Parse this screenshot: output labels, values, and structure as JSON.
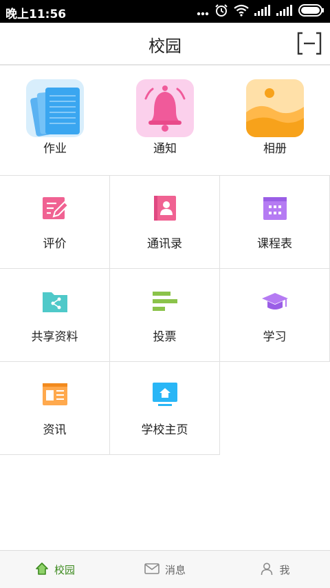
{
  "status_bar": {
    "time": "晚上11:56",
    "icons": [
      "dots-icon",
      "alarm-icon",
      "wifi-icon",
      "signal-icon",
      "signal-icon",
      "battery-icon"
    ]
  },
  "header": {
    "title": "校园",
    "scan_icon": "scan-icon"
  },
  "top_items": [
    {
      "label": "作业",
      "icon": "homework-notebook-icon"
    },
    {
      "label": "通知",
      "icon": "bell-icon"
    },
    {
      "label": "相册",
      "icon": "photo-album-icon"
    }
  ],
  "grid_items": [
    {
      "label": "评价",
      "icon": "evaluation-edit-icon",
      "color": "#f06292"
    },
    {
      "label": "通讯录",
      "icon": "contacts-icon",
      "color": "#f06292"
    },
    {
      "label": "课程表",
      "icon": "calendar-icon",
      "color": "#b57bf3"
    },
    {
      "label": "共享资料",
      "icon": "shared-folder-icon",
      "color": "#4fc9c9"
    },
    {
      "label": "投票",
      "icon": "vote-bars-icon",
      "color": "#8bc34a"
    },
    {
      "label": "学习",
      "icon": "graduation-cap-icon",
      "color": "#b57bf3"
    },
    {
      "label": "资讯",
      "icon": "news-icon",
      "color": "#ffa94d"
    },
    {
      "label": "学校主页",
      "icon": "school-home-icon",
      "color": "#29b6f6"
    }
  ],
  "tab_bar": {
    "tabs": [
      {
        "label": "校园",
        "icon": "home-icon",
        "active": true
      },
      {
        "label": "消息",
        "icon": "mail-icon",
        "active": false
      },
      {
        "label": "我",
        "icon": "person-icon",
        "active": false
      }
    ],
    "active_color": "#3c8a1e"
  }
}
